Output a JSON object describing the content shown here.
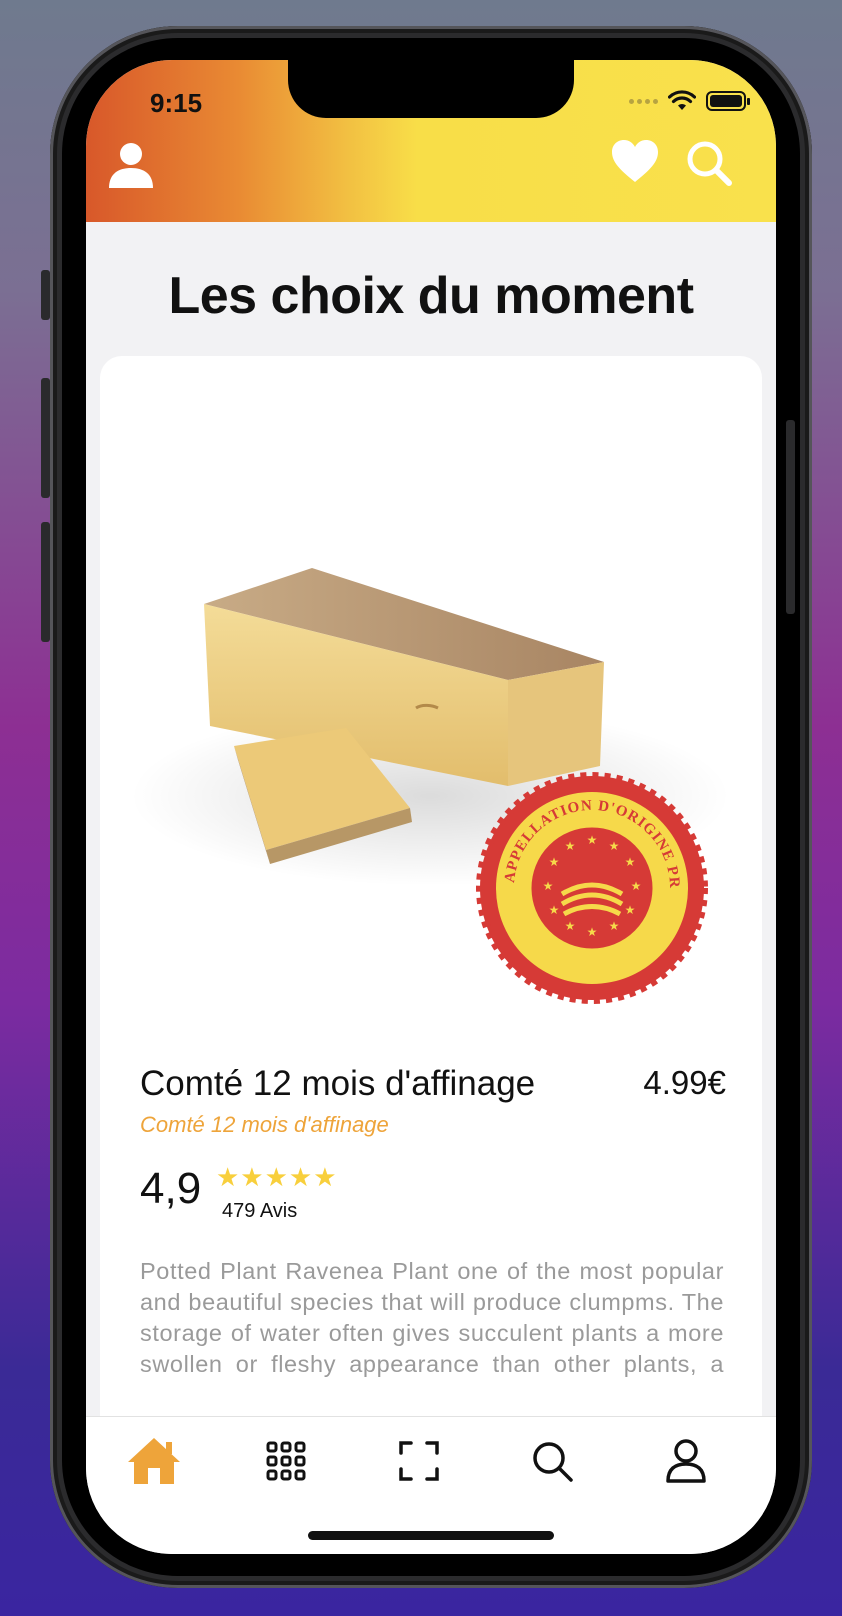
{
  "status_bar": {
    "time": "9:15"
  },
  "header": {
    "profile_icon": "person-icon",
    "favorite_icon": "heart-icon",
    "search_icon": "search-icon"
  },
  "page": {
    "title": "Les choix du moment"
  },
  "product": {
    "name": "Comté 12 mois d'affinage",
    "price": "4.99€",
    "subtitle": "Comté 12 mois d'affinage",
    "rating": "4,9",
    "stars": "★★★★★",
    "rating_value": 4.9,
    "reviews": "479 Avis",
    "description": "Potted Plant Ravenea Plant one of the most popular and beautiful species that will produce clumpms. The storage of water often gives succulent plants a more swollen or fleshy appearance than other plants, a characteristic",
    "badge_text": "APPELLATION D'ORIGINE PROTÉGÉE"
  },
  "tabbar": {
    "items": [
      {
        "name": "home",
        "icon": "home-icon",
        "active": true
      },
      {
        "name": "categories",
        "icon": "grid-icon",
        "active": false
      },
      {
        "name": "scan",
        "icon": "scan-icon",
        "active": false
      },
      {
        "name": "search",
        "icon": "search-icon",
        "active": false
      },
      {
        "name": "profile",
        "icon": "person-icon",
        "active": false
      }
    ]
  },
  "colors": {
    "accent": "#eea43a",
    "star": "#f8cf3c",
    "header_start": "#d8582a",
    "header_end": "#f9e14c",
    "badge_red": "#d63a36",
    "badge_yellow": "#f6d94a"
  }
}
